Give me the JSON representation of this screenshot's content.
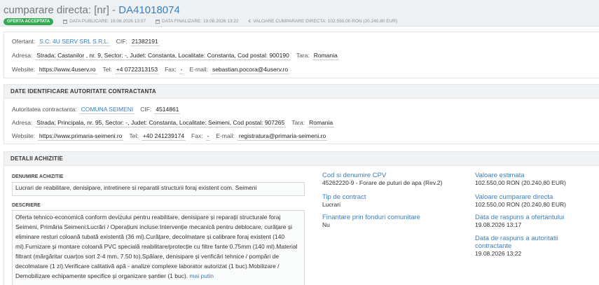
{
  "header": {
    "title_prefix": "cumparare directa: [nr] -",
    "title_code": "DA41018074",
    "badge": "OFERTA ACCEPTATA",
    "data_publicare_label": "DATA PUBLICARE:",
    "data_publicare": "19.08.2026 13:07",
    "data_finalizare_label": "DATA FINALIZARE:",
    "data_finalizare": "19.08.2026 13:22",
    "valoare_label": "VALOARE CUMPARARE DIRECTA:",
    "valoare": "102.550,00  RON (20.240,80  EUR)",
    "euro_symbol": "€"
  },
  "ofertant": {
    "ofertant_label": "Ofertant:",
    "ofertant_name": "S.C. 4U SERV SRL S.R.L.",
    "cif_label": "CIF:",
    "cif": "21382191",
    "adresa_label": "Adresa:",
    "adresa": "Strada: Castanilor , nr. 9, Sector: -, Judet: Constanta, Localitate: Constanta, Cod postal: 900190",
    "tara_label": "Tara:",
    "tara": "Romania",
    "website_label": "Website:",
    "website": "https://www.4userv.ro",
    "tel_label": "Tel:",
    "tel": "+4 0722313153",
    "fax_label": "Fax:",
    "fax": "-",
    "email_label": "E-mail:",
    "email": "sebastian.pocora@4userv.ro"
  },
  "autoritate": {
    "section_title": "DATE IDENTIFICARE AUTORITATE CONTRACTANTA",
    "autoritate_label": "Autoritatea contractanta:",
    "autoritate_name": "COMUNA SEIMENI",
    "cif_label": "CIF:",
    "cif": "4514861",
    "adresa_label": "Adresa:",
    "adresa": "Strada: Principala, nr. 95, Sector: -, Judet: Constanta, Localitate: Seimeni, Cod postal: 907265",
    "tara_label": "Tara:",
    "tara": "Romania",
    "website_label": "Website:",
    "website": "https://www.primaria-seimeni.ro",
    "tel_label": "Tel:",
    "tel": "+40 241239174",
    "fax_label": "Fax:",
    "fax": "-",
    "email_label": "E-mail:",
    "email": "registratura@primaria-seimeni.ro"
  },
  "detalii": {
    "section_title": "DETALII ACHIZITIE",
    "denumire_label": "DENUMIRE ACHIZITIE",
    "denumire": "Lucrari de reabilitare, denisipare, intretinere si reparatii structurii foraj existent com. Seimeni",
    "descriere_label": "DESCRIERE",
    "descriere": "Oferta tehnico-economică conform devizului pentru reabilitare, denisipare și reparații structurale foraj Seimeni, Primăria Seimeni:Lucrări / Operațiuni incluse:Intervenție mecanică pentru deblocare, curățare și eliminare resturi coloană tubată existentă (36 ml).Curățare, decolmatare și calibrare foraj existent (140 ml).Furnizare și montare coloană PVC specială reabilitare/protecție cu filtre fante 0.75mm (140 ml).Material filtrant (mărgăritar cuarțos sort 2-4 mm, 7.50 to).Spălare, denisipare și verificări tehnice / pompări de decolmatare (1 zi).Verificare calitativă apă - analize complexe laborator autorizat (1 buc).Mobilizare / Demobilizare echipamente specifice și organizare șantier (1 buc).",
    "more_link": "mai putin",
    "cpv_label": "Cod si denumire CPV",
    "cpv": "45262220-9 - Forare de puturi de apa (Rev.2)",
    "tip_label": "Tip de contract",
    "tip": "Lucrari",
    "finantare_label": "Finantare prin fonduri comunitare",
    "finantare": "Nu",
    "valoare_estimata_label": "Valoare estimata",
    "valoare_estimata": "102.550,00  RON (20.240,80  EUR)",
    "valoare_cumparare_label": "Valoare cumparare directa",
    "valoare_cumparare": "102.550,00  RON (20.240,80  EUR)",
    "raspuns_ofertant_label": "Data de raspuns a ofertantului",
    "raspuns_ofertant": "19.08.2026 13:17",
    "raspuns_autoritate_label": "Data de raspuns a autoritatii contractante",
    "raspuns_autoritate": "19.08.2026 13:22"
  }
}
